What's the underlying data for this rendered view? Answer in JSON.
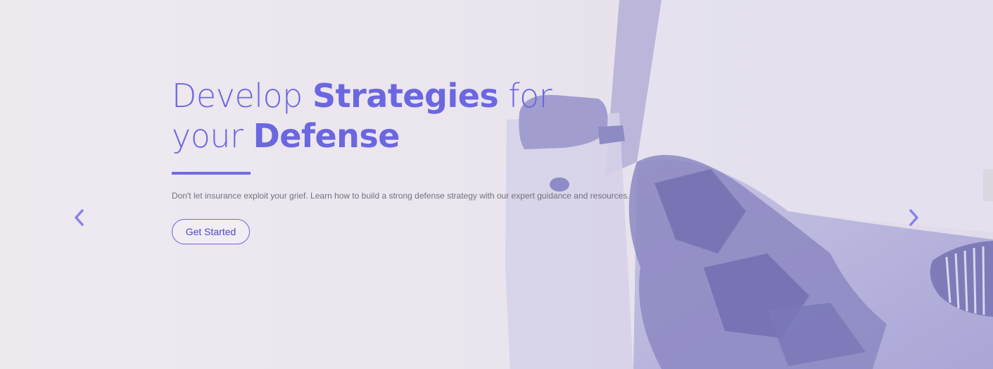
{
  "hero": {
    "headline": {
      "line1_light": "Develop ",
      "line1_bold": "Strategies",
      "line1_end": " for",
      "line2_light": "your ",
      "line2_bold": "Defense"
    },
    "description": "Don't let insurance exploit your grief. Learn how to build a strong defense strategy with our expert guidance and resources.",
    "cta_label": "Get Started"
  },
  "carousel": {
    "prev_icon": "chevron-left-icon",
    "next_icon": "chevron-right-icon"
  },
  "colors": {
    "accent": "#6b67e0",
    "background": "#efe9f0",
    "text_muted": "#74717d"
  }
}
